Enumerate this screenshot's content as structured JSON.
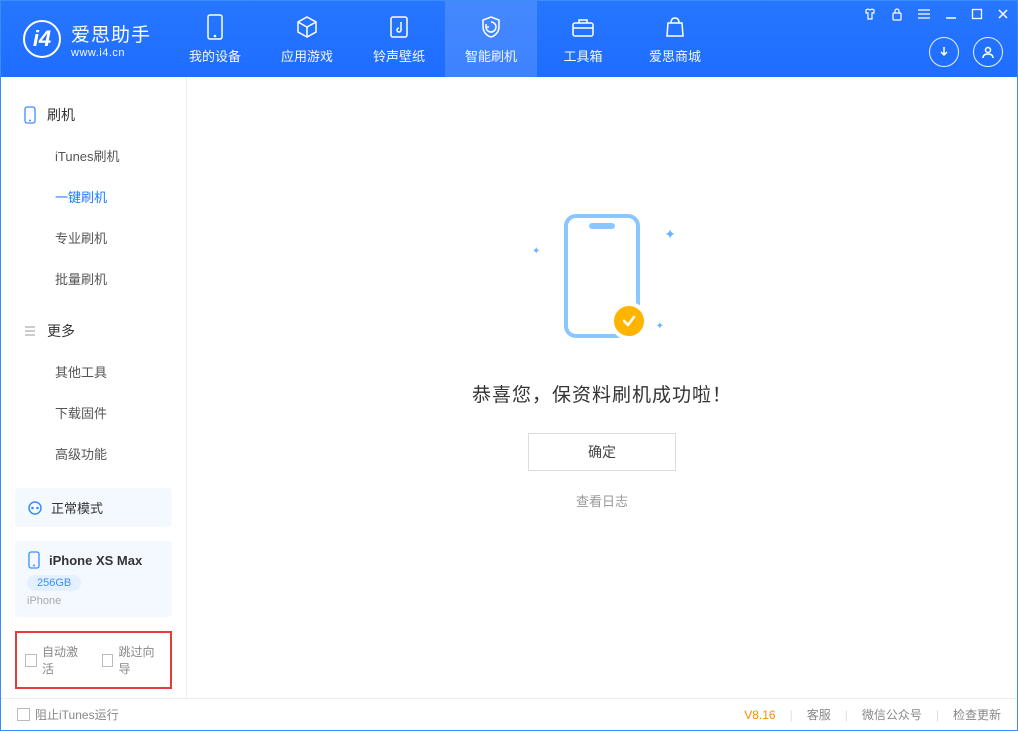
{
  "app": {
    "name_cn": "爱思助手",
    "name_en": "www.i4.cn"
  },
  "nav": {
    "items": [
      {
        "label": "我的设备"
      },
      {
        "label": "应用游戏"
      },
      {
        "label": "铃声壁纸"
      },
      {
        "label": "智能刷机"
      },
      {
        "label": "工具箱"
      },
      {
        "label": "爱思商城"
      }
    ]
  },
  "sidebar": {
    "section1_title": "刷机",
    "section1_items": [
      "iTunes刷机",
      "一键刷机",
      "专业刷机",
      "批量刷机"
    ],
    "section2_title": "更多",
    "section2_items": [
      "其他工具",
      "下载固件",
      "高级功能"
    ]
  },
  "device": {
    "mode": "正常模式",
    "name": "iPhone XS Max",
    "capacity": "256GB",
    "type": "iPhone"
  },
  "bottom_opts": {
    "auto_activate": "自动激活",
    "skip_guide": "跳过向导"
  },
  "main": {
    "message": "恭喜您，保资料刷机成功啦！",
    "ok": "确定",
    "view_log": "查看日志"
  },
  "footer": {
    "block_itunes": "阻止iTunes运行",
    "version": "V8.16",
    "support": "客服",
    "wechat": "微信公众号",
    "update": "检查更新"
  }
}
